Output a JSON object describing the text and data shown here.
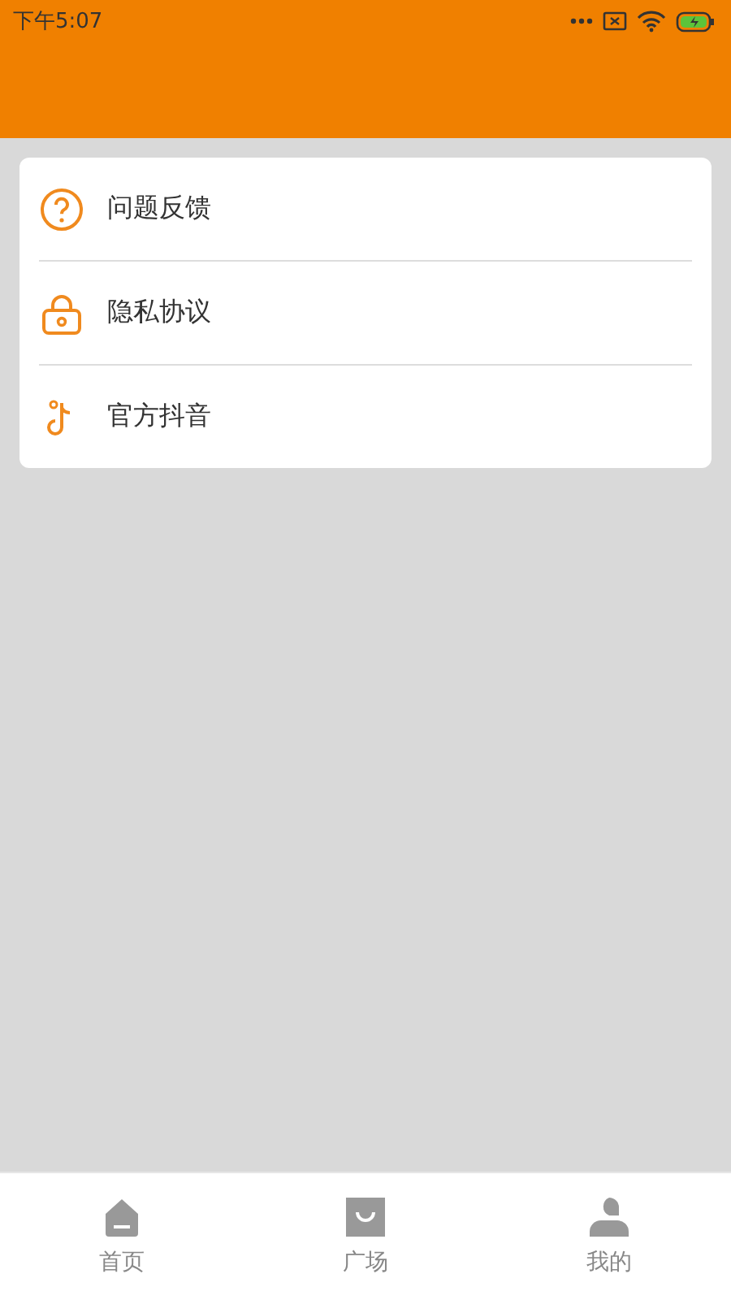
{
  "status_bar": {
    "time": "下午5:07"
  },
  "menu": [
    {
      "label": "问题反馈"
    },
    {
      "label": "隐私协议"
    },
    {
      "label": "官方抖音"
    }
  ],
  "tab_bar": [
    {
      "label": "首页"
    },
    {
      "label": "广场"
    },
    {
      "label": "我的"
    }
  ]
}
